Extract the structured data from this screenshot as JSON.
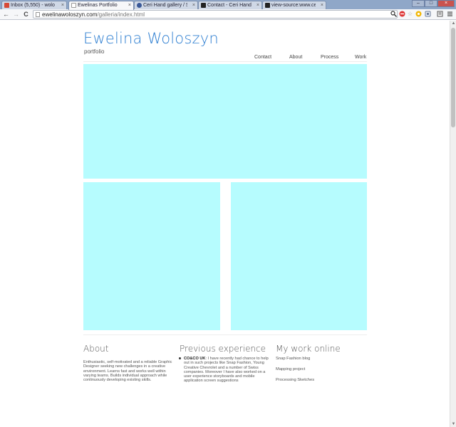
{
  "browser": {
    "tabs": [
      {
        "label": "Inbox (5,550) - wolo",
        "icon_color": "#d64937"
      },
      {
        "label": "Ewelinas Portfolio",
        "icon_color": "#ffffff"
      },
      {
        "label": "Ceri Hand gallery / S",
        "icon_color": "#3a5998"
      },
      {
        "label": "Contact - Ceri Hand",
        "icon_color": "#222222"
      },
      {
        "label": "view-source:www.ce",
        "icon_color": "#222222"
      }
    ],
    "close_glyph": "×",
    "window_controls": {
      "minimize": "–",
      "maximize": "□",
      "close": "×"
    },
    "nav": {
      "back": "←",
      "forward": "→",
      "reload": "C"
    },
    "url_host": "ewelinawoloszyn.com",
    "url_path": "/galleria/index.html",
    "toolbar_icons": [
      "search-icon",
      "stop-icon",
      "star-icon",
      "extension-icon",
      "extension-icon",
      "settings-icon"
    ]
  },
  "page": {
    "title": "Ewelina Woloszyn",
    "subtitle": "portfolio",
    "nav": [
      "Contact",
      "About",
      "Process",
      "Work"
    ],
    "accent_color": "#2f7fd1",
    "tile_color": "#b6fcfe"
  },
  "footer": {
    "about": {
      "heading": "About",
      "text": "Enthusiastic, self-motivated and a reliable Graphic Designer seeking new challenges in a creative environment. Learns fast and works well within varying teams. Builds individual approach while continuously developing existing skills."
    },
    "experience": {
      "heading": "Previous experience",
      "company": "CO&CO UK",
      "text": ": I have recently had chance to help out in such projects like Snap Fashion, Young Creative Chevrolet and a number of Swiss companies. Moreover I have also worked on a user experience storyboards and mobile application screen suggestions"
    },
    "online": {
      "heading": "My work online",
      "links": [
        "Snap Fashion blog",
        "Mapping project",
        "Processing Sketches"
      ]
    }
  }
}
